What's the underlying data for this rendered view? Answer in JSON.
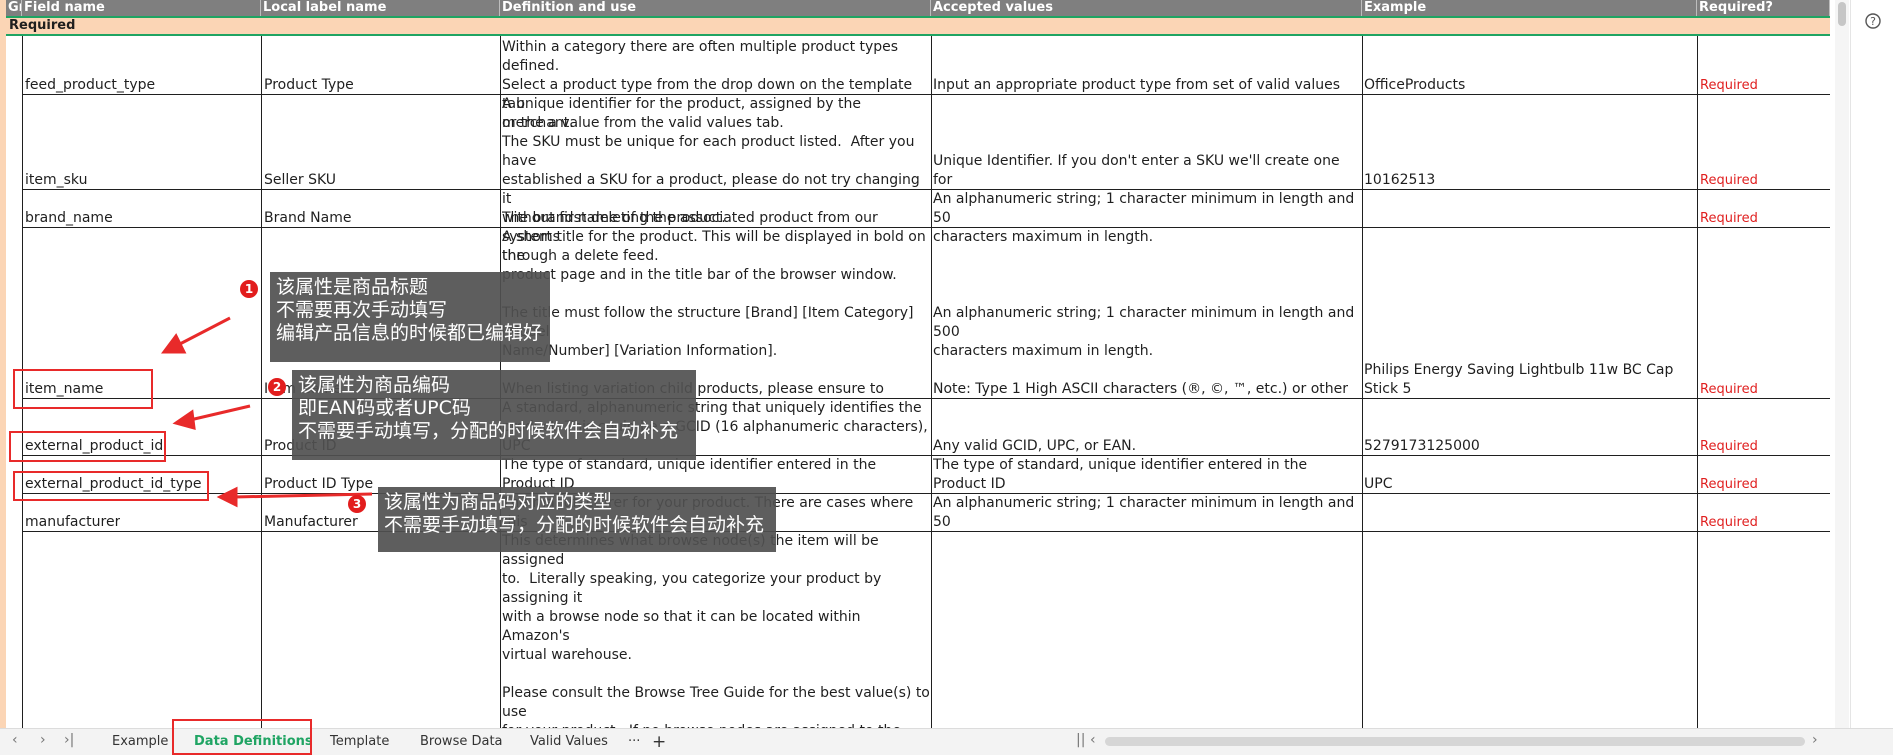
{
  "headers": {
    "group": "Gr",
    "field_name": "Field name",
    "local_label": "Local label name",
    "definition": "Definition and use",
    "accepted": "Accepted values",
    "example": "Example",
    "required": "Required?"
  },
  "group_row": "Required",
  "rows": [
    {
      "field": "feed_product_type",
      "label": "Product Type",
      "definition": "Within a category there are often multiple product types defined.\nSelect a product type from the drop down on the template tab\nor the a value from the valid values tab.",
      "accepted": "Input an appropriate product type from set of valid values",
      "example": "OfficeProducts",
      "required": "Required"
    },
    {
      "field": "item_sku",
      "label": "Seller SKU",
      "definition": "A unique identifier for the product, assigned by the merchant.\nThe SKU must be unique for each product listed.  After you have\nestablished a SKU for a product, please do not try changing it\nwithout first deleting the associated product from our systems\nthrough a delete feed.",
      "accepted": "Unique Identifier. If you don't enter a SKU we'll create one for\nyou.",
      "example": "10162513",
      "required": "Required"
    },
    {
      "field": "brand_name",
      "label": "Brand Name",
      "definition": "The brand name of the product.",
      "accepted": "An alphanumeric string; 1 character minimum in length and 50\ncharacters maximum in length.",
      "example": "",
      "required": "Required"
    },
    {
      "field": "item_name",
      "label": "Item Name",
      "definition": "A short title for the product. This will be displayed in bold on the\nproduct page and in the title bar of the browser window.\n\nThe title must follow the structure [Brand] [Item Category] [Model\nName/Number] [Variation Information].\n\nWhen listing variation child products, please ensure to include the\nvariation information like e.g colour in the product's name to\ndifferentiate items.",
      "accepted": "An alphanumeric string; 1 character minimum in length and 500\ncharacters maximum in length.\n\nNote: Type 1 High ASCII characters (®, ©, ™, etc.) or other\nspecial characters are not supported.",
      "example": "Philips Energy Saving Lightbulb 11w BC Cap Stick 5\nPack",
      "required": "Required"
    },
    {
      "field": "external_product_id",
      "label": "Product ID",
      "definition": "A standard, alphanumeric string that uniquely identifies the\nproduct. This could be a GCID (16 alphanumeric characters), UPC\nor EAN. This is a required field if product_id_type is provided.",
      "accepted": "Any valid GCID, UPC, or EAN.",
      "example": "5279173125000",
      "required": "Required"
    },
    {
      "field": "external_product_id_type",
      "label": "Product ID Type",
      "definition": "The type of standard, unique identifier entered in the Product ID\nfield. This is a required field if Product ID is provided.",
      "accepted": "The type of standard, unique identifier entered in the Product ID\nfield. This is a required field if Product ID is provided.",
      "example": "UPC",
      "required": "Required"
    },
    {
      "field": "manufacturer",
      "label": "Manufacturer",
      "definition": "The manufacturer for your product. There are cases where this\nmay be the same as the brand name.",
      "accepted": "An alphanumeric string; 1 character minimum in length and 50\ncharacters maximum in length.",
      "example": "",
      "required": "Required"
    },
    {
      "field": "",
      "label": "",
      "definition": "This determines what browse node(s) the item will be assigned\nto.  Literally speaking, you categorize your product by assigning it\nwith a browse node so that it can be located within Amazon's\nvirtual warehouse.\n\nPlease consult the Browse Tree Guide for the best value(s) to use\nfor your product.  If no browse nodes are assigned to the\nproduct, your product will not be browsable and will also not be\nindexed. Supplying proper browse node information has a very\nhigh impact on the number of sales per product.",
      "accepted": "",
      "example": "",
      "required": ""
    }
  ],
  "callouts": [
    {
      "num": "1",
      "line1": "该属性是商品标题",
      "line2": "不需要再次手动填写",
      "line3": "编辑产品信息的时候都已编辑好"
    },
    {
      "num": "2",
      "line1": "该属性为商品编码",
      "line2": "即EAN码或者UPC码",
      "line3": "不需要手动填写，分配的时候软件会自动补充"
    },
    {
      "num": "3",
      "line1": "该属性为商品码对应的类型",
      "line2": "不需要手动填写，分配的时候软件会自动补充"
    }
  ],
  "tabs": [
    "Example",
    "Data Definitions",
    "Template",
    "Browse Data",
    "Valid Values"
  ],
  "active_tab": "Data Definitions",
  "more_tabs": "···",
  "add_tab": "+",
  "icons": [
    "nav-first-icon",
    "nav-prev-icon",
    "nav-next-icon",
    "nav-last-icon",
    "help-icon"
  ],
  "colors": {
    "header_bg": "#7f7f7f",
    "group_bg": "#fbd5b5",
    "accent": "#1fa463",
    "required": "#e02020",
    "callout": "#505050",
    "highlight": "#e82a2a"
  }
}
